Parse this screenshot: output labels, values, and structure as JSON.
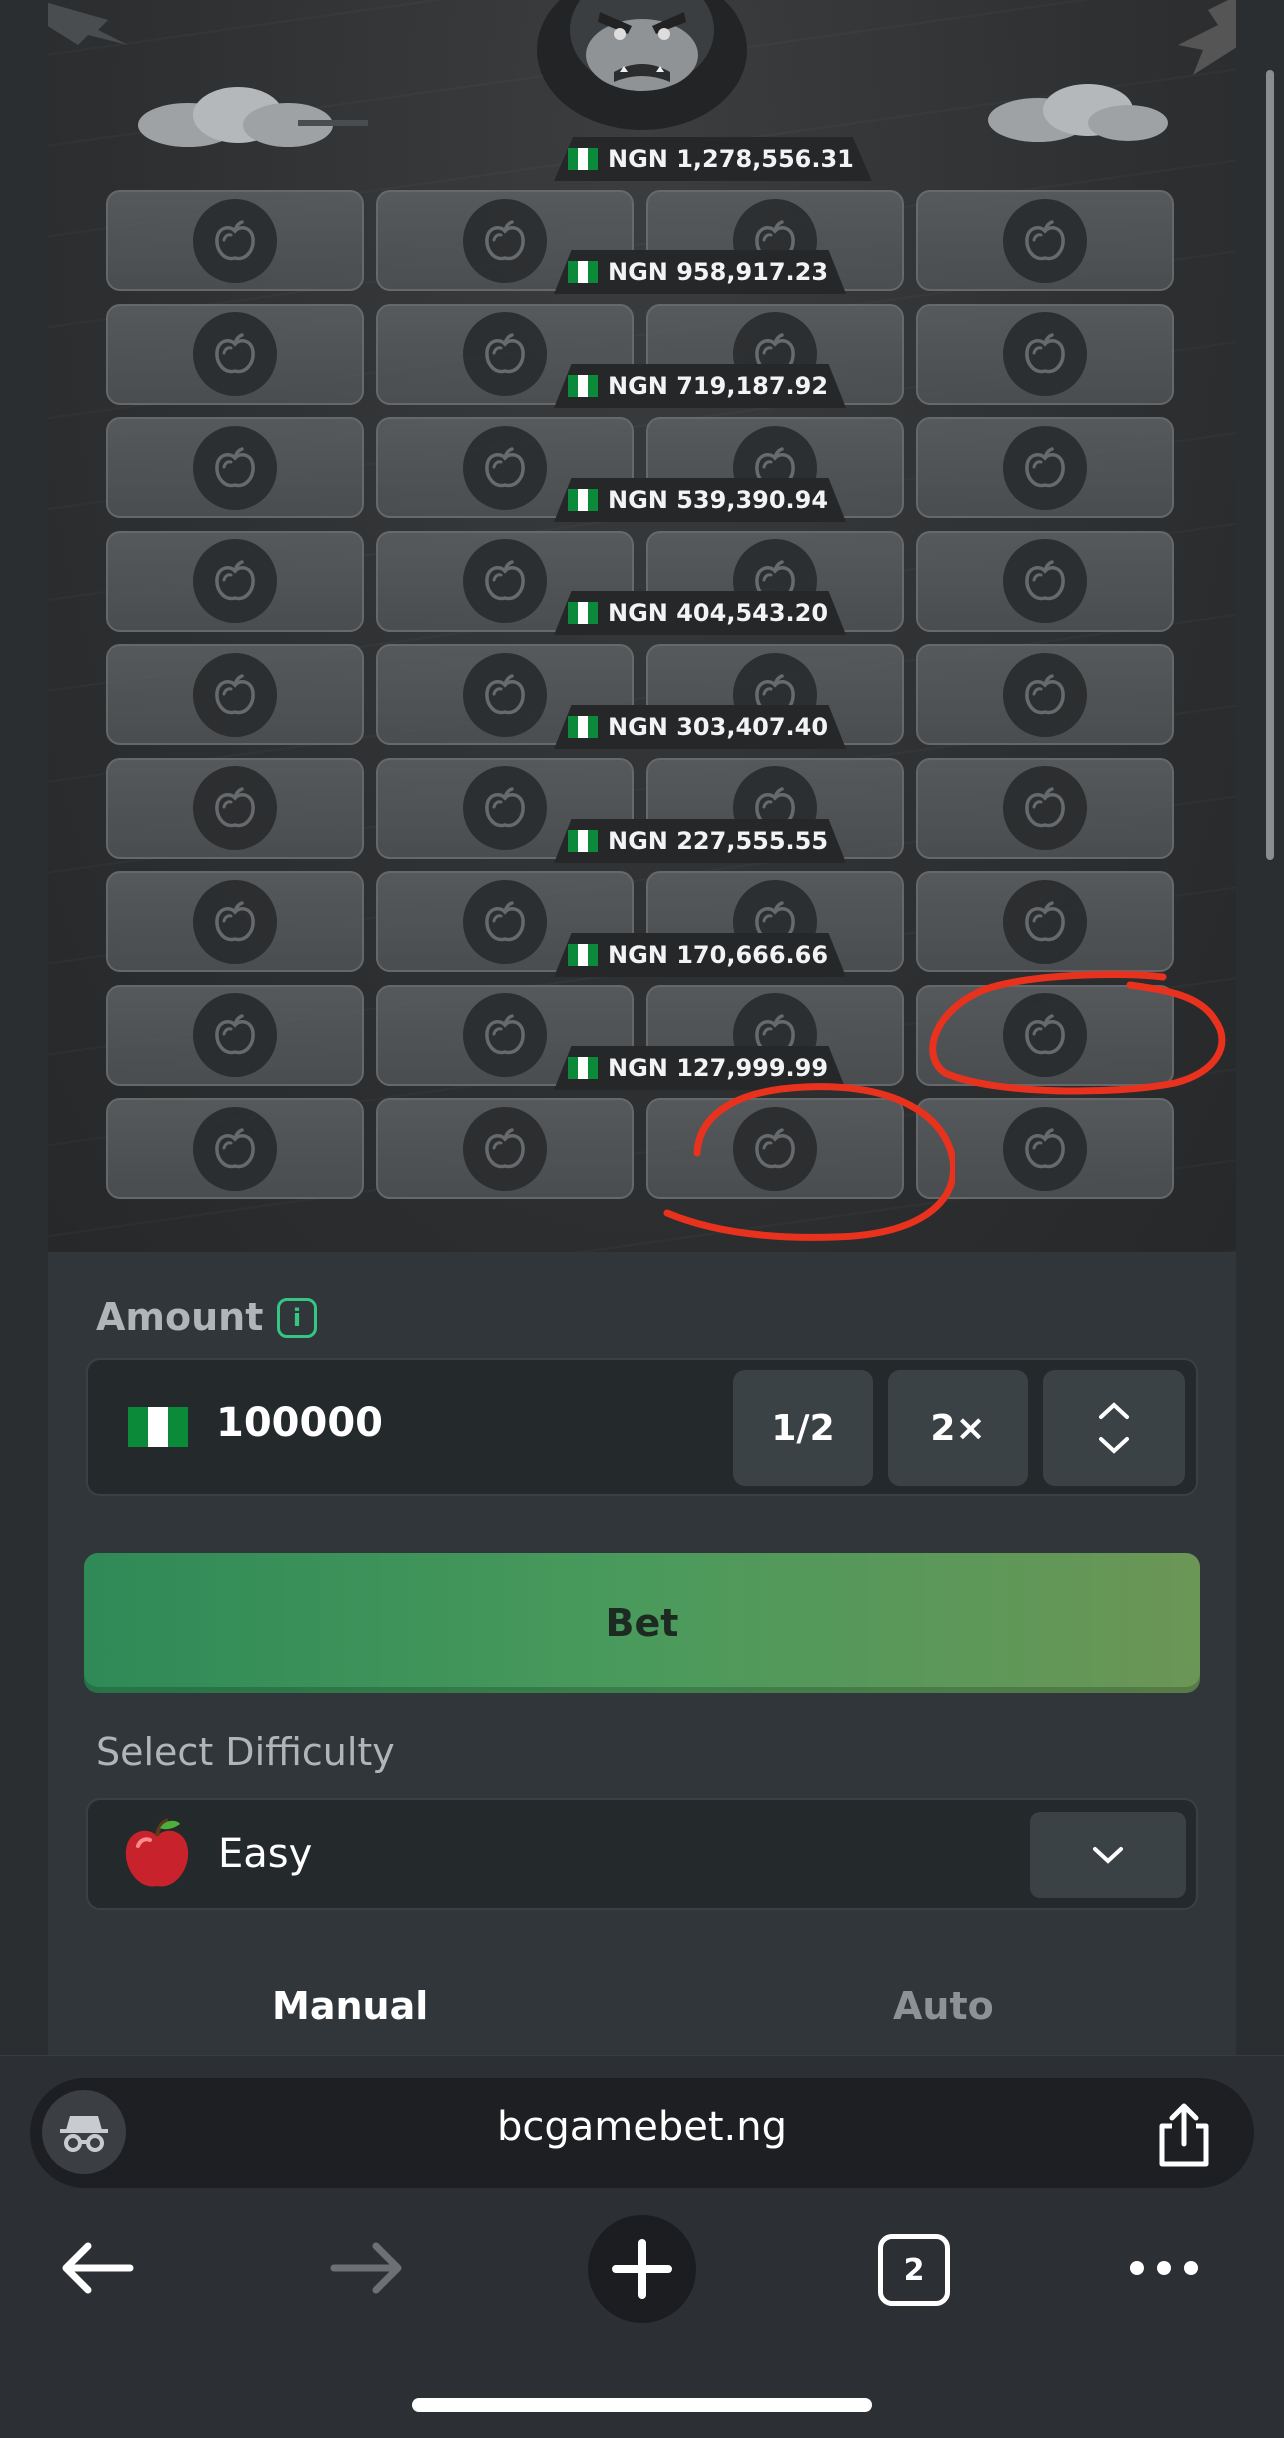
{
  "payouts": [
    "NGN 1,278,556.31",
    "NGN 958,917.23",
    "NGN 719,187.92",
    "NGN 539,390.94",
    "NGN 404,543.20",
    "NGN 303,407.40",
    "NGN 227,555.55",
    "NGN 170,666.66",
    "NGN 127,999.99"
  ],
  "controls": {
    "amount_label": "Amount",
    "info_icon": "i",
    "amount_value": "100000",
    "half_label": "1/2",
    "double_label": "2×",
    "bet_label": "Bet",
    "difficulty_label": "Select Difficulty",
    "difficulty_value": "Easy",
    "tab_manual": "Manual",
    "tab_auto": "Auto"
  },
  "browser": {
    "url": "bcgamebet.ng",
    "tab_count": "2"
  },
  "colors": {
    "accent_green": "#35c684",
    "bet_green": "#3a925a",
    "annotation_red": "#e8321e",
    "nigeria_green": "#0b8a3a"
  },
  "icons": [
    "apple-icon",
    "info-icon",
    "chevron-up-icon",
    "chevron-down-icon",
    "incognito-icon",
    "share-icon",
    "back-arrow-icon",
    "forward-arrow-icon",
    "plus-icon",
    "more-icon"
  ]
}
